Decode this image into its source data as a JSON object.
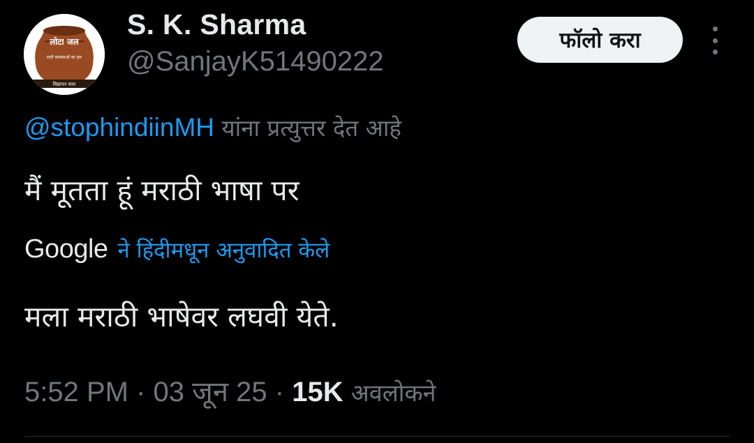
{
  "author": {
    "display_name": "S. K. Sharma",
    "handle": "@SanjayK51490222",
    "avatar_text": {
      "top": "लोटा जल",
      "middle": "सारी समस्याओं का हल",
      "bottom": "विद्यापन समा"
    }
  },
  "follow_button": {
    "label": "फॉलो करा"
  },
  "more_icon": "more-vertical-icon",
  "reply_context": {
    "mention": "@stophindiinMH",
    "suffix": "यांना प्रत्युत्तर देत आहे"
  },
  "tweet_text": "मैं मूतता हूं मराठी भाषा पर",
  "translation": {
    "provider": "Google",
    "label": "ने हिंदीमधून अनुवादित केले",
    "text": "मला मराठी भाषेवर लघवी येते."
  },
  "meta": {
    "time": "5:52 PM",
    "date": "03 जून 25",
    "separator": "·",
    "views_count": "15K",
    "views_label": "अवलोकने"
  },
  "colors": {
    "background": "#000000",
    "text": "#e7e9ea",
    "secondary": "#71767b",
    "link": "#1d9bf0",
    "button_bg": "#eff3f4"
  }
}
